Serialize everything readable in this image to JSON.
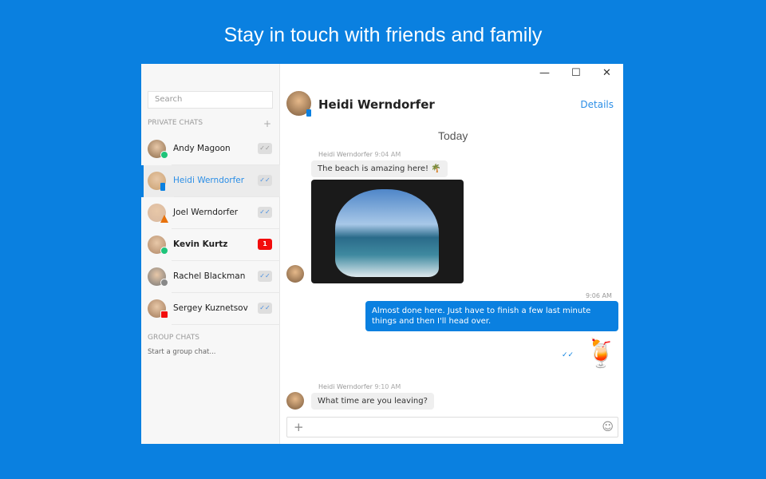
{
  "headline": "Stay in touch with friends and family",
  "window_controls": {
    "minimize": "—",
    "maximize": "☐",
    "close": "✕"
  },
  "sidebar": {
    "search_placeholder": "Search",
    "private_label": "PRIVATE CHATS",
    "add": "+",
    "group_label": "GROUP CHATS",
    "group_hint": "Start a group chat...",
    "contacts": [
      {
        "name": "Andy Magoon",
        "status": "online",
        "status_color": "#1ec47a",
        "indicator": "✓✓",
        "unread": null,
        "selected": false
      },
      {
        "name": "Heidi Werndorfer",
        "status": "mobile",
        "status_color": "#0a80e0",
        "indicator": "✓✓",
        "unread": null,
        "selected": true
      },
      {
        "name": "Joel Werndorfer",
        "status": "away",
        "status_color": "#e8720c",
        "indicator": "✓✓",
        "unread": null,
        "selected": false
      },
      {
        "name": "Kevin Kurtz",
        "status": "online",
        "status_color": "#1ec47a",
        "indicator": null,
        "unread": "1",
        "selected": false
      },
      {
        "name": "Rachel Blackman",
        "status": "offline",
        "status_color": "#888888",
        "indicator": "✓✓",
        "unread": null,
        "selected": false
      },
      {
        "name": "Sergey Kuznetsov",
        "status": "busy",
        "status_color": "#f20c0c",
        "indicator": "✓✓",
        "unread": null,
        "selected": false
      }
    ]
  },
  "chat": {
    "title": "Heidi Werndorfer",
    "details": "Details",
    "day": "Today",
    "messages": [
      {
        "sender": "Heidi Werndorfer",
        "time": "9:04 AM",
        "text": "The beach is amazing here! 🌴"
      },
      {
        "sender": "me",
        "time": "9:06 AM",
        "text": "Almost done here. Just have to finish a few last minute things and then I'll head over.",
        "sticker": "🍹",
        "read": "✓✓"
      },
      {
        "sender": "Heidi Werndorfer",
        "time": "9:10 AM",
        "text": "What time are you leaving?"
      }
    ],
    "input_add": "+",
    "emoji_icon": "☺"
  },
  "colors": {
    "accent": "#0a80e0",
    "background": "#0a80e0"
  }
}
